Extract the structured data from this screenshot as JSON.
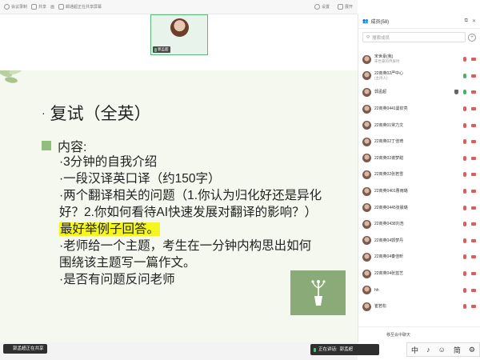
{
  "topbar": {
    "items": [
      "会议录制",
      "共享",
      "画",
      "邮通超正在共享屏幕"
    ],
    "right_items": [
      "设置",
      "展开"
    ]
  },
  "video": {
    "participant_name": "郭孟超"
  },
  "slide": {
    "title": "复试（全英）",
    "bullet": "·",
    "content_label": "内容:",
    "items": [
      "·3分钟的自我介绍",
      "·一段汉译英口译（约150字）",
      "·两个翻译相关的问题（1.你认为归化好还是异化好？2.你如何看待AI快速发展对翻译的影响？）",
      "·老师给一个主题，考生在一分钟内构思出如何围绕该主题写一篇作文。",
      "·是否有问题反问老师"
    ],
    "highlight": "最好举例子回答。"
  },
  "bottombar": {
    "share_text": "郭孟超正在共享",
    "speaking_label": "正在讲话:",
    "speaking_name": "郭孟超"
  },
  "panel": {
    "title": "成员(58)",
    "search_placeholder": "搜索成员",
    "members": [
      {
        "name": "宋世豪(我)",
        "sub": "宋世豪的传屏时",
        "mic": "red",
        "cam": "red"
      },
      {
        "name": "22商英02严中心",
        "sub": "(主持人)",
        "mic": "green",
        "cam": "red"
      },
      {
        "name": "郭孟超",
        "sub": "",
        "mic": "green",
        "cam": "red"
      },
      {
        "name": "22商英0441曼钦亮",
        "sub": "",
        "mic": "red",
        "cam": "red"
      },
      {
        "name": "22商英01常力文",
        "sub": "",
        "mic": "red",
        "cam": "red"
      },
      {
        "name": "22商英02丁佳琦",
        "sub": "",
        "mic": "red",
        "cam": "red"
      },
      {
        "name": "22商英02谢梦甜",
        "sub": "",
        "mic": "red",
        "cam": "red"
      },
      {
        "name": "22商英02张若雪",
        "sub": "",
        "mic": "red",
        "cam": "red"
      },
      {
        "name": "22商英0401曹雨璐",
        "sub": "",
        "mic": "red",
        "cam": "red"
      },
      {
        "name": "22商英0445张晨璐",
        "sub": "",
        "mic": "red",
        "cam": "red"
      },
      {
        "name": "22商英0438刘浩",
        "sub": "",
        "mic": "red",
        "cam": "red"
      },
      {
        "name": "22商英04郭梦丹",
        "sub": "",
        "mic": "red",
        "cam": "red"
      },
      {
        "name": "22商英04秦佳昕",
        "sub": "",
        "mic": "red",
        "cam": "red"
      },
      {
        "name": "22商英04张蓝艺",
        "sub": "",
        "mic": "red",
        "cam": "red"
      },
      {
        "name": "hh",
        "sub": "",
        "mic": "red",
        "cam": "red"
      },
      {
        "name": "崔若松",
        "sub": "",
        "mic": "red",
        "cam": "red"
      }
    ],
    "bottom_text": "移至会中聊天"
  },
  "ime": {
    "items": [
      "中",
      "♪",
      "☺",
      "简",
      "⚙"
    ]
  }
}
